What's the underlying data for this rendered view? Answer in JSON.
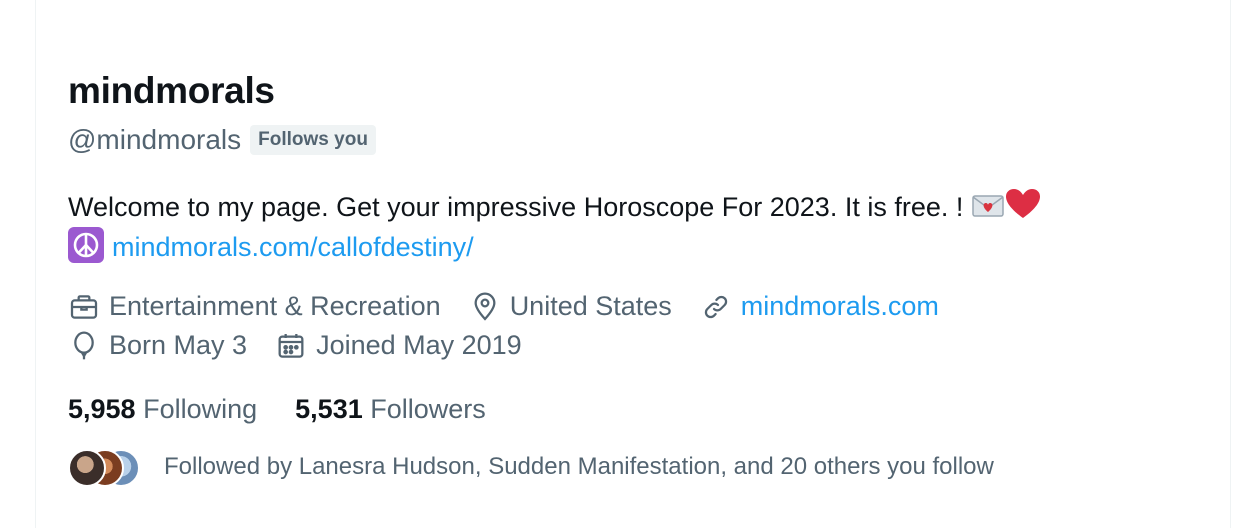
{
  "profile": {
    "display_name": "mindmorals",
    "handle": "@mindmorals",
    "follows_badge": "Follows you",
    "bio_text": "Welcome to my page. Get your impressive Horoscope For 2023. It is free. !",
    "bio_link": "mindmorals.com/callofdestiny/",
    "bio_icons": [
      "love-letter-icon",
      "red-heart-icon",
      "peace-symbol-icon"
    ]
  },
  "meta": {
    "category": "Entertainment & Recreation",
    "location": "United States",
    "website": "mindmorals.com",
    "birthday": "Born May 3",
    "joined": "Joined May 2019"
  },
  "counts": {
    "following_num": "5,958",
    "following_label": "Following",
    "followers_num": "5,531",
    "followers_label": "Followers"
  },
  "followed_by": {
    "text": "Followed by Lanesra Hudson, Sudden Manifestation, and 20 others you follow"
  },
  "colors": {
    "link": "#1d9bf0",
    "secondary_text": "#536471",
    "primary_text": "#0f1419",
    "badge_bg": "#eff3f4"
  }
}
